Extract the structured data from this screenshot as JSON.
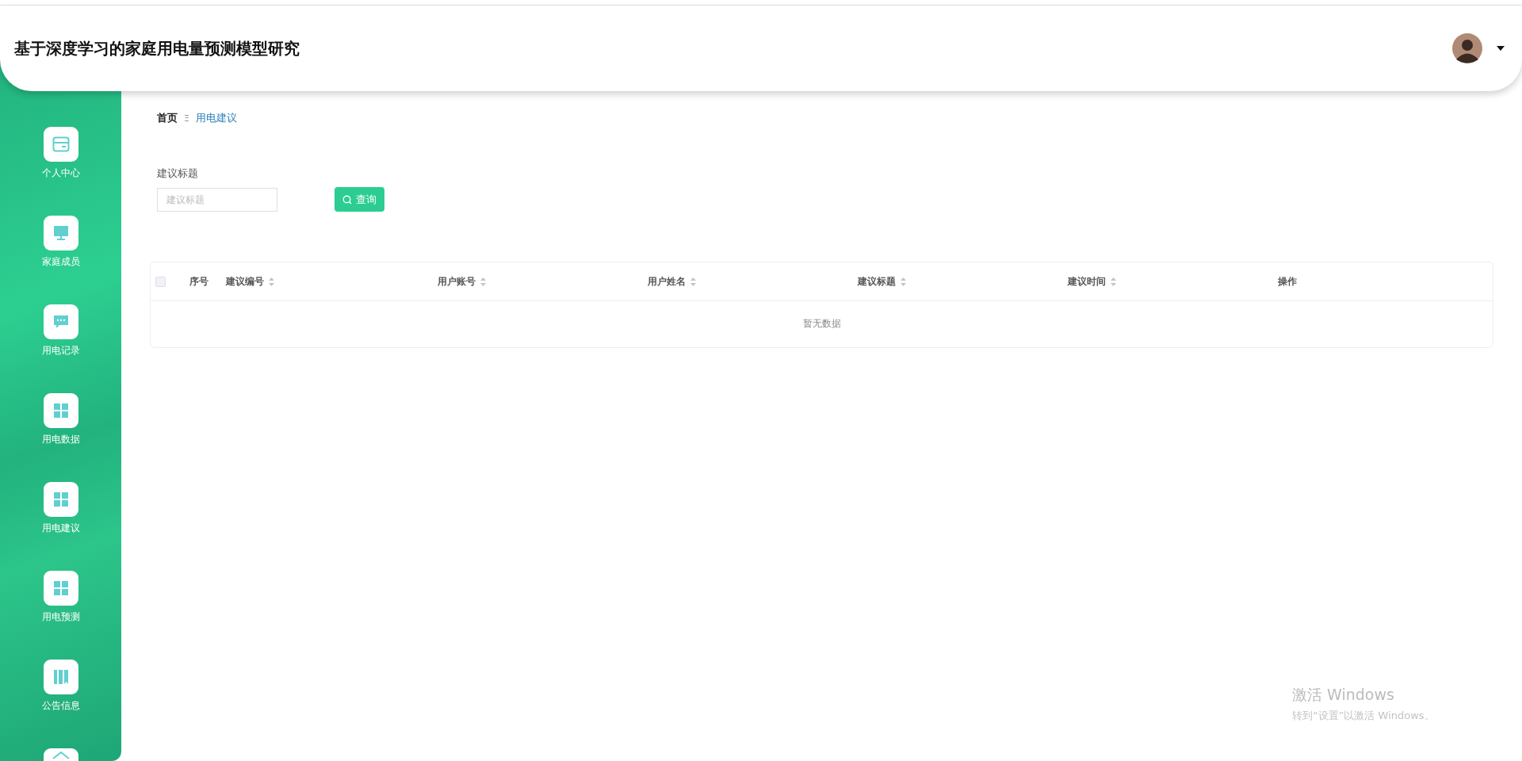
{
  "header": {
    "title": "基于深度学习的家庭用电量预测模型研究"
  },
  "sidebar": {
    "items": [
      {
        "kind": "card",
        "label": "个人中心"
      },
      {
        "kind": "monitor",
        "label": "家庭成员"
      },
      {
        "kind": "chat",
        "label": "用电记录"
      },
      {
        "kind": "grid",
        "label": "用电数据"
      },
      {
        "kind": "grid",
        "label": "用电建议"
      },
      {
        "kind": "grid",
        "label": "用电预测"
      },
      {
        "kind": "book",
        "label": "公告信息"
      },
      {
        "kind": "roof"
      }
    ]
  },
  "breadcrumb": {
    "items": [
      "首页",
      "用电建议"
    ],
    "separator": "Ξ"
  },
  "search": {
    "label": "建议标题",
    "placeholder": "建议标题",
    "button": "查询"
  },
  "table": {
    "columns": [
      {
        "label": "序号",
        "sortable": false
      },
      {
        "label": "建议编号",
        "sortable": true
      },
      {
        "label": "用户账号",
        "sortable": true
      },
      {
        "label": "用户姓名",
        "sortable": true
      },
      {
        "label": "建议标题",
        "sortable": true
      },
      {
        "label": "建议时间",
        "sortable": true
      },
      {
        "label": "操作",
        "sortable": false
      }
    ],
    "select_all": {
      "checked": false
    },
    "empty_text": "暂无数据"
  },
  "os_notice": {
    "title": "激活 Windows",
    "text": "转到“设置”以激活 Windows。"
  }
}
